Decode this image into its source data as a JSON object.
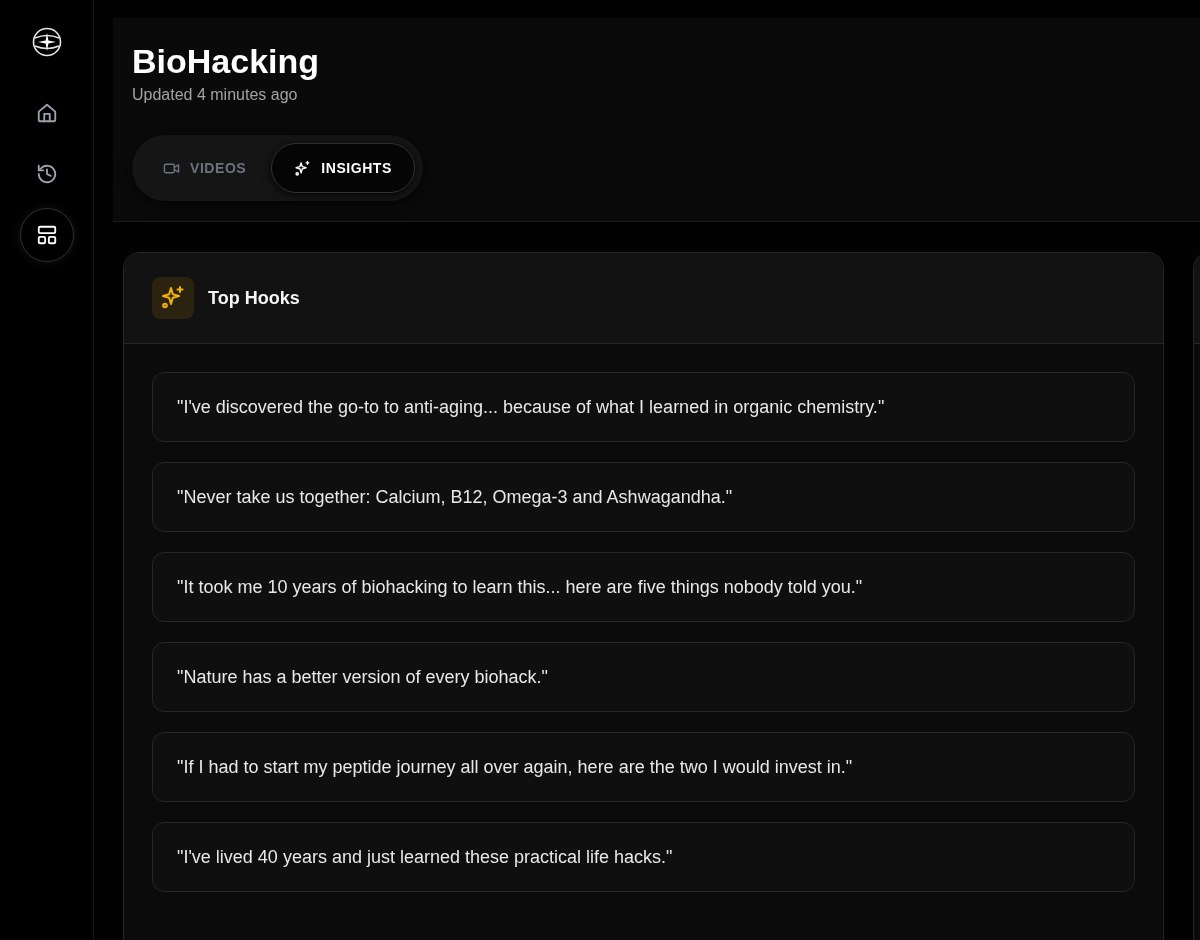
{
  "sidebar": {
    "items": [
      {
        "kind": "home",
        "selected": false
      },
      {
        "kind": "history",
        "selected": false
      },
      {
        "kind": "layout",
        "selected": true
      }
    ]
  },
  "header": {
    "title": "BioHacking",
    "subtitle": "Updated 4 minutes ago"
  },
  "tabs": [
    {
      "label": "VIDEOS",
      "kind": "video",
      "selected": false
    },
    {
      "label": "INSIGHTS",
      "kind": "sparkles",
      "selected": true
    }
  ],
  "cards": [
    {
      "title": "Top Hooks",
      "items": [
        "\"I've discovered the go-to to anti-aging... because of what I learned in organic chemistry.\"",
        "\"Never take us together: Calcium, B12, Omega-3 and Ashwagandha.\"",
        "\"It took me 10 years of biohacking to learn this... here are five things nobody told you.\"",
        "\"Nature has a better version of every biohack.\"",
        "\"If I had to start my peptide journey all over again, here are the two I would invest in.\"",
        "\"I've lived 40 years and just learned these practical life hacks.\""
      ]
    }
  ]
}
